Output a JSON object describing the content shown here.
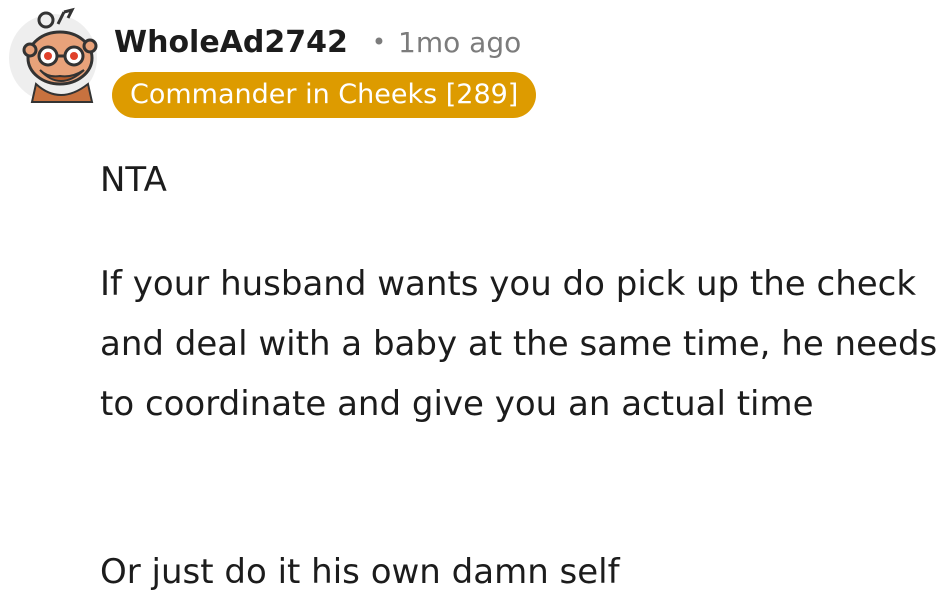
{
  "comment": {
    "username": "WholeAd2742",
    "separator": "•",
    "timestamp": "1mo ago",
    "flair": "Commander in Cheeks [289]",
    "paragraphs": [
      "NTA",
      "If your husband wants you do pick up the check and deal with a baby at the same time, he needs to coordinate and give you an actual time",
      "Or just do it his own damn self"
    ],
    "avatar_icon": "snoo-avatar-icon"
  },
  "colors": {
    "flair_background": "#dd9b00",
    "flair_text": "#ffffff",
    "meta_text": "#7c7c7c",
    "body_text": "#1c1c1c"
  }
}
